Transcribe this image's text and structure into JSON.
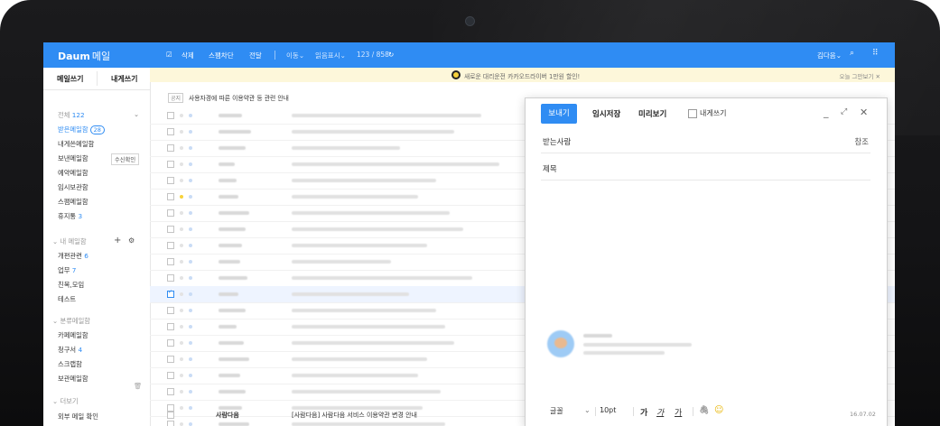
{
  "app": {
    "logo_brand": "Daum",
    "logo_label": "메일"
  },
  "toolbar": {
    "delete": "삭제",
    "spam_block": "스팸차단",
    "forward": "전달",
    "move": "이동",
    "mark_read": "읽음표시",
    "count": "123 / 858",
    "user": "김다음",
    "refresh_icon": "refresh-icon",
    "search_icon": "search-icon",
    "apps_icon": "grid-icon"
  },
  "sidebar": {
    "compose": "메일쓰기",
    "to_me": "내게쓰기",
    "all": "전체",
    "all_count": "122",
    "items": [
      {
        "label": "받은메일함",
        "count": "28"
      },
      {
        "label": "내게쓴메일함"
      },
      {
        "label": "보낸메일함",
        "button": "수신확인"
      },
      {
        "label": "예약메일함"
      },
      {
        "label": "임시보관함"
      },
      {
        "label": "스팸메일함"
      },
      {
        "label": "휴지통",
        "count": "3"
      }
    ],
    "my_mailbox": "내 메일함",
    "my_items": [
      {
        "label": "개편관련",
        "count": "6"
      },
      {
        "label": "업무",
        "count": "7"
      },
      {
        "label": "친목,모임"
      },
      {
        "label": "테스트"
      }
    ],
    "category": "분류메일함",
    "cat_items": [
      {
        "label": "카페메일함"
      },
      {
        "label": "청구서",
        "count": "4"
      },
      {
        "label": "스크랩함"
      },
      {
        "label": "보관메일함"
      }
    ],
    "more": "더보기",
    "external": "외부 메일 확인"
  },
  "banner": {
    "text": "새로운 대리운전 카카오드라이버 1만원 할인!",
    "right": "오늘 그만보기"
  },
  "notice": {
    "tag": "공지",
    "text": "사용자경에 따른 이용약관 등 관련 안내"
  },
  "compose": {
    "send": "보내기",
    "save_draft": "임시저장",
    "preview": "미리보기",
    "to_self": "내게쓰기",
    "to_label": "받는사람",
    "cc_label": "참조",
    "subject_label": "제목",
    "font_label": "글꼴",
    "font_size": "10pt",
    "bold": "가",
    "italic": "가",
    "underline": "가"
  },
  "last_row": {
    "sender": "사람다음",
    "subject": "[사람다음] 사람다음 서비스 이용약관 변경 안내",
    "date": "16.07.02"
  }
}
